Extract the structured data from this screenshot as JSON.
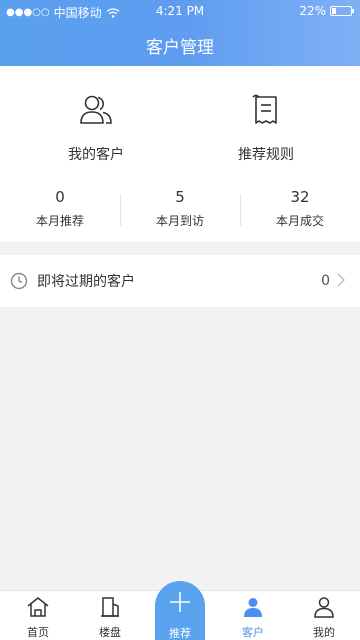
{
  "status_bar": {
    "carrier": "中国移动",
    "time": "4:21 PM",
    "battery": "22%"
  },
  "header": {
    "title": "客户管理"
  },
  "features": [
    {
      "label": "我的客户",
      "icon": "users-icon"
    },
    {
      "label": "推荐规则",
      "icon": "receipt-icon"
    }
  ],
  "stats": [
    {
      "value": "0",
      "label": "本月推荐"
    },
    {
      "value": "5",
      "label": "本月到访"
    },
    {
      "value": "32",
      "label": "本月成交"
    }
  ],
  "expiring": {
    "label": "即将过期的客户",
    "count": "0"
  },
  "tabbar": {
    "home": "首页",
    "buildings": "楼盘",
    "recommend": "推荐",
    "customers": "客户",
    "mine": "我的"
  },
  "colors": {
    "primary": "#5aa0ee",
    "active": "#4b8ff0"
  }
}
